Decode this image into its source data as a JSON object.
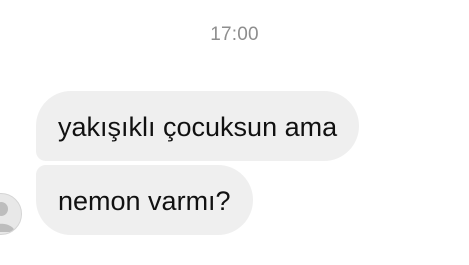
{
  "conversation": {
    "timestamp": "17:00",
    "messages": [
      {
        "text": "yakışıklı çocuksun ama"
      },
      {
        "text": "nemon varmı?"
      }
    ]
  },
  "colors": {
    "bubble_background": "#efefef",
    "timestamp_text": "#8e8e8e",
    "message_text": "#111111"
  },
  "icons": {
    "avatar": "user-avatar-icon"
  }
}
